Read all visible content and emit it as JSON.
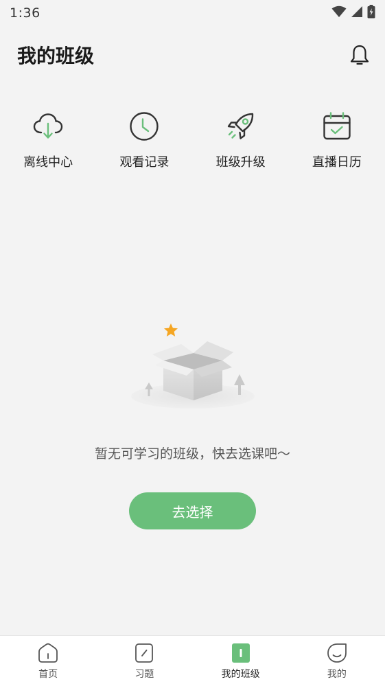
{
  "status_bar": {
    "time": "1:36",
    "icons": [
      "wifi-icon",
      "signal-icon",
      "battery-charging-icon"
    ]
  },
  "header": {
    "title": "我的班级",
    "bell_icon": "bell-icon"
  },
  "quick_actions": [
    {
      "label": "离线中心",
      "icon": "cloud-download-icon"
    },
    {
      "label": "观看记录",
      "icon": "clock-icon"
    },
    {
      "label": "班级升级",
      "icon": "rocket-icon"
    },
    {
      "label": "直播日历",
      "icon": "calendar-check-icon"
    }
  ],
  "empty_state": {
    "illustration": "empty-box-icon",
    "message": "暂无可学习的班级，快去选课吧～",
    "button_label": "去选择"
  },
  "bottom_nav": [
    {
      "label": "首页",
      "icon": "home-icon",
      "active": false
    },
    {
      "label": "习题",
      "icon": "edit-icon",
      "active": false
    },
    {
      "label": "我的班级",
      "icon": "class-icon",
      "active": true
    },
    {
      "label": "我的",
      "icon": "profile-icon",
      "active": false
    }
  ],
  "colors": {
    "accent": "#6abf7b",
    "background": "#f3f3f3",
    "star": "#f5a623"
  }
}
